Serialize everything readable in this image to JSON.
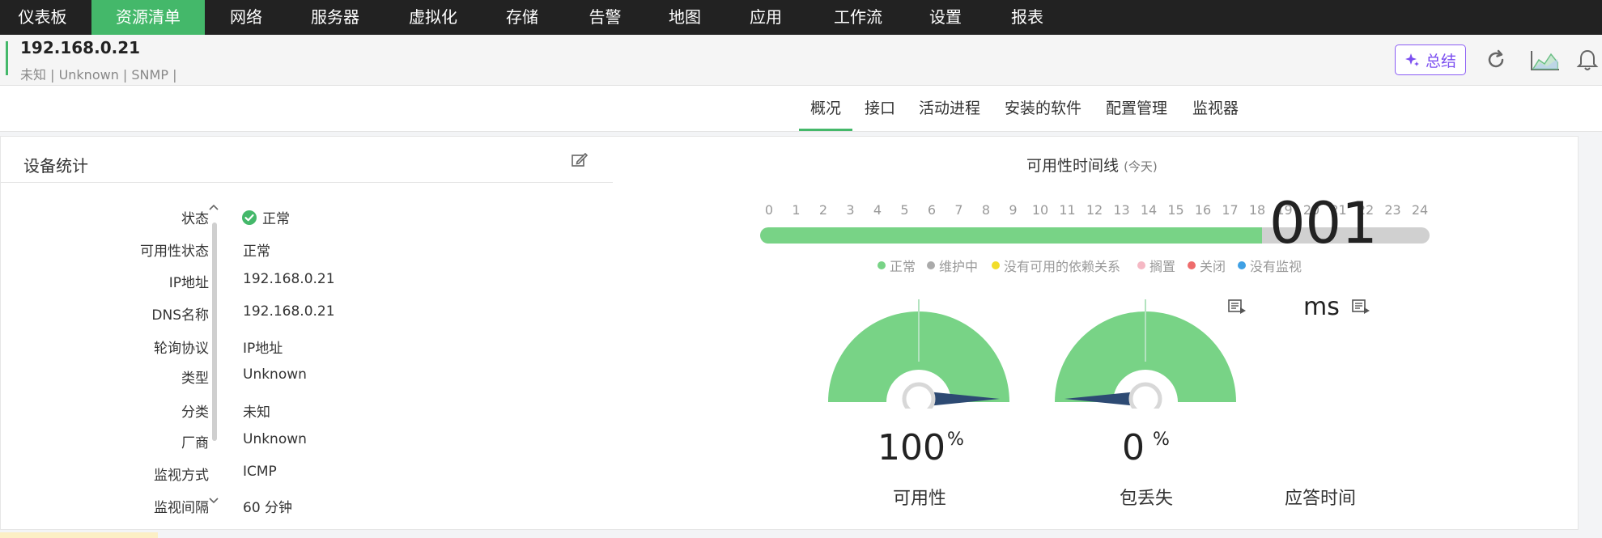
{
  "nav": {
    "items": [
      "仪表板",
      "资源清单",
      "网络",
      "服务器",
      "虚拟化",
      "存储",
      "告警",
      "地图",
      "应用",
      "工作流",
      "设置",
      "报表"
    ],
    "active": "资源清单"
  },
  "device": {
    "ip": "192.168.0.21",
    "meta": "未知 | Unknown | SNMP |",
    "summary_label": "总结"
  },
  "tabs": {
    "items": [
      "概况",
      "接口",
      "活动进程",
      "安装的软件",
      "配置管理",
      "监视器"
    ],
    "active": "概况"
  },
  "stats": {
    "title": "设备统计",
    "rows": [
      {
        "label": "状态",
        "value": "正常"
      },
      {
        "label": "可用性状态",
        "value": "正常"
      },
      {
        "label": "IP地址",
        "value": "192.168.0.21"
      },
      {
        "label": "DNS名称",
        "value": "192.168.0.21"
      },
      {
        "label": "轮询协议",
        "value": "IP地址"
      },
      {
        "label": "类型",
        "value": "Unknown"
      },
      {
        "label": "分类",
        "value": "未知"
      },
      {
        "label": "厂商",
        "value": "Unknown"
      },
      {
        "label": "监视方式",
        "value": "ICMP"
      },
      {
        "label": "监视间隔",
        "value": "60 分钟"
      }
    ]
  },
  "timeline": {
    "title": "可用性时间线",
    "subtitle": "(今天)",
    "hours": [
      "0",
      "1",
      "2",
      "3",
      "4",
      "5",
      "6",
      "7",
      "8",
      "9",
      "10",
      "11",
      "12",
      "13",
      "14",
      "15",
      "16",
      "17",
      "18",
      "19",
      "20",
      "21",
      "22",
      "23",
      "24"
    ],
    "normal_until_hour": 18,
    "legend": [
      {
        "label": "正常",
        "color": "#78d386"
      },
      {
        "label": "维护中",
        "color": "#aaaaaa"
      },
      {
        "label": "没有可用的依赖关系",
        "color": "#f2dd2a"
      },
      {
        "label": "搁置",
        "color": "#f5b8c4"
      },
      {
        "label": "关闭",
        "color": "#ee6c6c"
      },
      {
        "label": "没有监视",
        "color": "#3fa0e4"
      }
    ]
  },
  "metrics": {
    "availability": {
      "value": "100",
      "unit": "%",
      "label": "可用性",
      "percent": 100
    },
    "packet_loss": {
      "value": "0",
      "unit": "%",
      "label": "包丢失",
      "percent": 0
    },
    "response_time": {
      "value": "001",
      "unit": "ms",
      "label": "应答时间"
    }
  },
  "colors": {
    "accent": "#44b86a",
    "gauge_fill": "#78d386",
    "needle": "#2d4a73",
    "summary_purple": "#7b4ef0"
  }
}
